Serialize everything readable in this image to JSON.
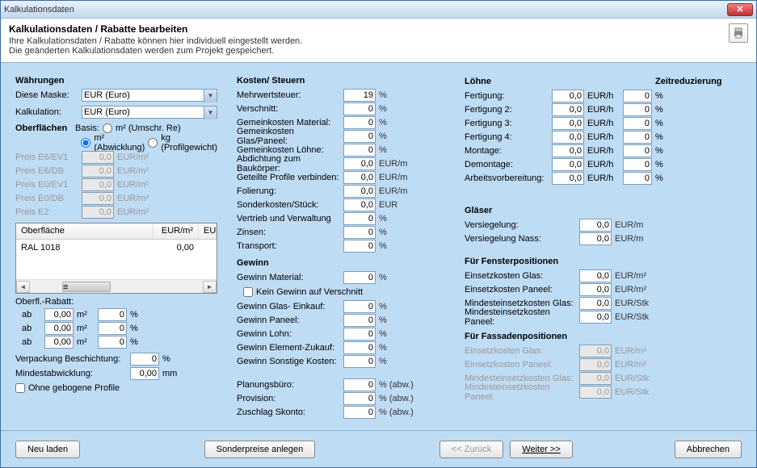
{
  "title": "Kalkulationsdaten",
  "header": {
    "title": "Kalkulationsdaten / Rabatte bearbeiten",
    "line1": "Ihre Kalkulationsdaten / Rabatte können hier individuell eingestellt werden.",
    "line2": "Die geänderten Kalkulationsdaten werden zum Projekt gespeichert."
  },
  "waehrungen": {
    "title": "Währungen",
    "diese_maske_lbl": "Diese Maske:",
    "diese_maske_val": "EUR (Euro)",
    "kalkulation_lbl": "Kalkulation:",
    "kalkulation_val": "EUR (Euro)"
  },
  "oberflaechen": {
    "title": "Oberflächen",
    "basis_lbl": "Basis:",
    "opt1": "m² (Umschr. Re)",
    "opt2": "m² (Abwicklung)",
    "opt3": "kg (Profilgewicht)",
    "rows": [
      {
        "lbl": "Preis E6/EV1",
        "val": "0,0",
        "unit": "EUR/m²"
      },
      {
        "lbl": "Preis E6/DB",
        "val": "0,0",
        "unit": "EUR/m²"
      },
      {
        "lbl": "Preis E0/EV1",
        "val": "0,0",
        "unit": "EUR/m²"
      },
      {
        "lbl": "Preis E0/DB",
        "val": "0,0",
        "unit": "EUR/m²"
      },
      {
        "lbl": "Preis E2",
        "val": "0,0",
        "unit": "EUR/m²"
      }
    ],
    "table": {
      "col1": "Oberfläche",
      "col2": "EUR/m²",
      "col3": "EU",
      "row_name": "RAL 1018",
      "row_val": "0,00"
    },
    "rabatt_lbl": "Oberfl.-Rabatt:",
    "ab": "ab",
    "ab_vals": [
      "0,00",
      "0,00",
      "0,00"
    ],
    "ab_pct": [
      "0",
      "0",
      "0"
    ],
    "m2": "m²",
    "pct": "%",
    "verpackung_lbl": "Verpackung Beschichtung:",
    "verpackung_val": "0",
    "mindest_lbl": "Mindestabwicklung:",
    "mindest_val": "0,00",
    "mm": "mm",
    "ohne_gebogene": "Ohne gebogene Profile"
  },
  "kosten": {
    "title": "Kosten/ Steuern",
    "rows": [
      {
        "lbl": "Mehrwertsteuer:",
        "val": "19",
        "unit": "%"
      },
      {
        "lbl": "Verschnitt:",
        "val": "0",
        "unit": "%"
      },
      {
        "lbl": "Gemeinkosten Material:",
        "val": "0",
        "unit": "%"
      },
      {
        "lbl": "Gemeinkosten Glas/Paneel:",
        "val": "0",
        "unit": "%"
      },
      {
        "lbl": "Gemeinkosten Löhne:",
        "val": "0",
        "unit": "%"
      },
      {
        "lbl": "Abdichtung zum Baukörper:",
        "val": "0,0",
        "unit": "EUR/m"
      },
      {
        "lbl": "Geteilte Profile verbinden:",
        "val": "0,0",
        "unit": "EUR/m"
      },
      {
        "lbl": "Folierung:",
        "val": "0,0",
        "unit": "EUR/m"
      },
      {
        "lbl": "Sonderkosten/Stück:",
        "val": "0,0",
        "unit": "EUR"
      },
      {
        "lbl": "Vertrieb und Verwaltung",
        "val": "0",
        "unit": "%"
      },
      {
        "lbl": "Zinsen:",
        "val": "0",
        "unit": "%"
      },
      {
        "lbl": "Transport:",
        "val": "0",
        "unit": "%"
      }
    ]
  },
  "gewinn": {
    "title": "Gewinn",
    "material_lbl": "Gewinn Material:",
    "material_val": "0",
    "kein_gewinn": "Kein Gewinn auf Verschnitt",
    "rows": [
      {
        "lbl": "Gewinn Glas- Einkauf:",
        "val": "0",
        "unit": "%"
      },
      {
        "lbl": "Gewinn Paneel:",
        "val": "0",
        "unit": "%"
      },
      {
        "lbl": "Gewinn Lohn:",
        "val": "0",
        "unit": "%"
      },
      {
        "lbl": "Gewinn Element-Zukauf:",
        "val": "0",
        "unit": "%"
      },
      {
        "lbl": "Gewinn Sonstige Kosten:",
        "val": "0",
        "unit": "%"
      }
    ],
    "bottom": [
      {
        "lbl": "Planungsbüro:",
        "val": "0",
        "unit": "% (abw.)"
      },
      {
        "lbl": "Provision:",
        "val": "0",
        "unit": "% (abw.)"
      },
      {
        "lbl": "Zuschlag Skonto:",
        "val": "0",
        "unit": "% (abw.)"
      }
    ]
  },
  "loehne": {
    "title": "Löhne",
    "rows": [
      {
        "lbl": "Fertigung:",
        "val": "0,0"
      },
      {
        "lbl": "Fertigung 2:",
        "val": "0,0"
      },
      {
        "lbl": "Fertigung 3:",
        "val": "0,0"
      },
      {
        "lbl": "Fertigung 4:",
        "val": "0,0"
      },
      {
        "lbl": "Montage:",
        "val": "0,0"
      },
      {
        "lbl": "Demontage:",
        "val": "0,0"
      },
      {
        "lbl": "Arbeitsvorbereitung:",
        "val": "0,0"
      }
    ],
    "unit": "EUR/h"
  },
  "zeit": {
    "title": "Zeitreduzierung",
    "vals": [
      "0",
      "0",
      "0",
      "0",
      "0",
      "0",
      "0"
    ],
    "unit": "%"
  },
  "glaeser": {
    "title": "Gläser",
    "rows": [
      {
        "lbl": "Versiegelung:",
        "val": "0,0",
        "unit": "EUR/m"
      },
      {
        "lbl": "Versiegelung Nass:",
        "val": "0,0",
        "unit": "EUR/m"
      }
    ]
  },
  "fenster": {
    "title": "Für Fensterpositionen",
    "rows": [
      {
        "lbl": "Einsetzkosten Glas:",
        "val": "0,0",
        "unit": "EUR/m²"
      },
      {
        "lbl": "Einsetzkosten Paneel:",
        "val": "0,0",
        "unit": "EUR/m²"
      },
      {
        "lbl": "Mindesteinsetzkosten Glas:",
        "val": "0,0",
        "unit": "EUR/Stk"
      },
      {
        "lbl": "Mindesteinsetzkosten Paneel:",
        "val": "0,0",
        "unit": "EUR/Stk"
      }
    ]
  },
  "fassade": {
    "title": "Für Fassadenpositionen",
    "rows": [
      {
        "lbl": "Einsetzkosten Glas:",
        "val": "0,0",
        "unit": "EUR/m²"
      },
      {
        "lbl": "Einsetzkosten Paneel:",
        "val": "0,0",
        "unit": "EUR/m²"
      },
      {
        "lbl": "Mindesteinsetzkosten Glas:",
        "val": "0,0",
        "unit": "EUR/Stk"
      },
      {
        "lbl": "Mindesteinsetzkosten Paneel:",
        "val": "0,0",
        "unit": "EUR/Stk"
      }
    ]
  },
  "buttons": {
    "neu": "Neu laden",
    "sonder": "Sonderpreise anlegen",
    "zurueck": "<< Zurück",
    "weiter": "Weiter >>",
    "abbrechen": "Abbrechen"
  }
}
